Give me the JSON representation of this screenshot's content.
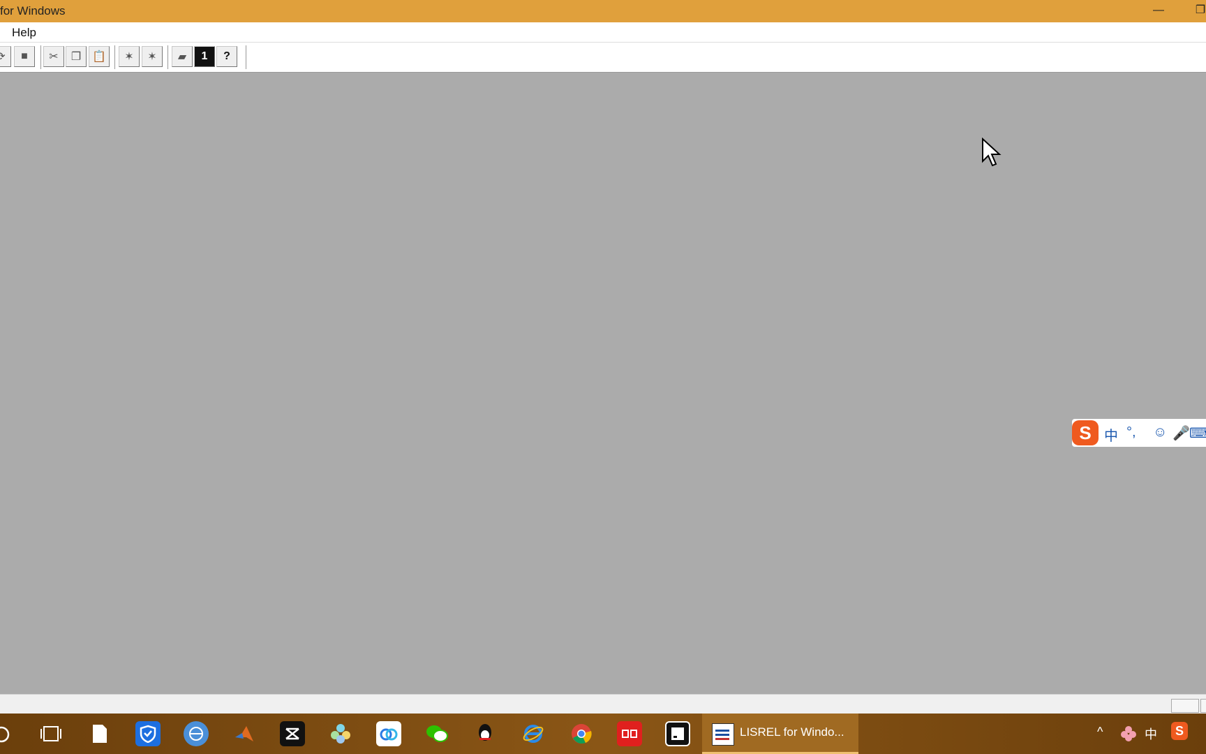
{
  "window": {
    "title": "for Windows",
    "minimize_glyph": "—",
    "restore_glyph": "❐"
  },
  "menu": {
    "help": "Help"
  },
  "toolbar": {
    "buttons": [
      {
        "name": "refresh-icon",
        "glyph": "⟳"
      },
      {
        "name": "stop-icon",
        "glyph": "■"
      },
      {
        "name": "cut-icon",
        "glyph": "✂"
      },
      {
        "name": "copy-icon",
        "glyph": "❐"
      },
      {
        "name": "paste-icon",
        "glyph": "📋"
      },
      {
        "name": "run-icon",
        "glyph": "✶"
      },
      {
        "name": "run-all-icon",
        "glyph": "✶"
      },
      {
        "name": "print-icon",
        "glyph": "▰"
      },
      {
        "name": "info-icon",
        "glyph": "1"
      },
      {
        "name": "help-icon",
        "glyph": "?"
      }
    ]
  },
  "ime": {
    "logo": "S",
    "lang": "中",
    "punct": "°,",
    "emoji": "☺",
    "mic": "🎤",
    "keyboard": "⌨"
  },
  "taskbar": {
    "active_app_label": "LISREL for Windo...",
    "tray_lang": "中",
    "tray_chevron": "^",
    "tray_sogou": "S"
  }
}
